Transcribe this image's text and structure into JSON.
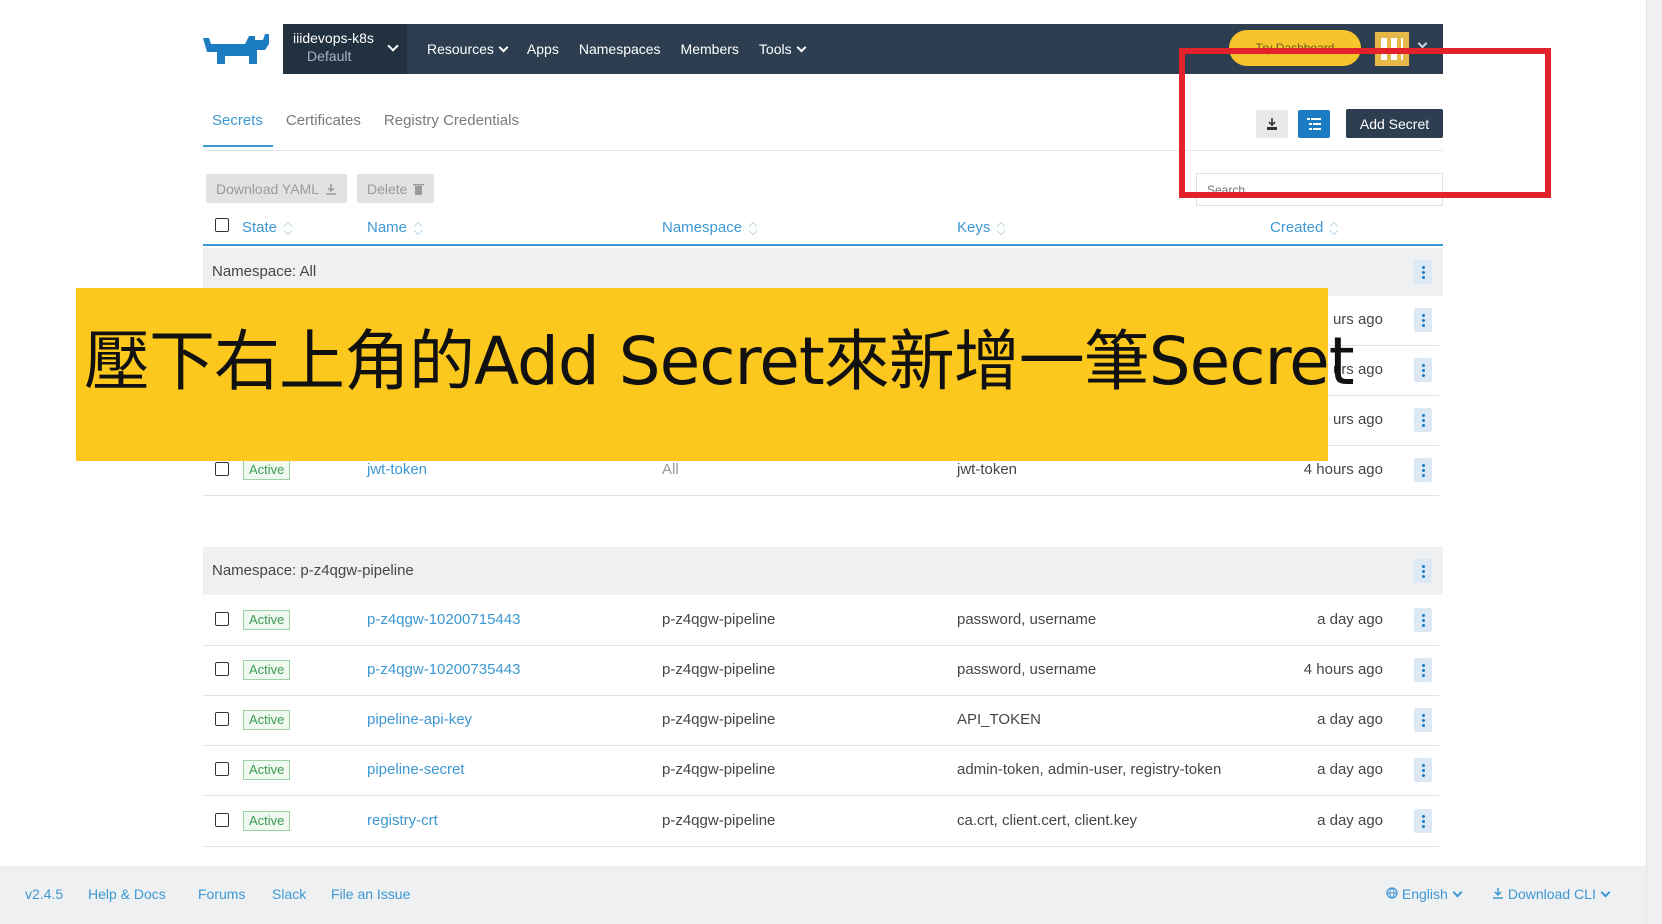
{
  "header": {
    "cluster_name": "iiidevops-k8s",
    "project_name": "Default",
    "nav": [
      "Resources",
      "Apps",
      "Namespaces",
      "Members",
      "Tools"
    ],
    "dashboard_button": "Try Dashboard"
  },
  "tabs": [
    "Secrets",
    "Certificates",
    "Registry Credentials"
  ],
  "toolbar": {
    "add_secret": "Add Secret",
    "download_yaml": "Download YAML",
    "delete": "Delete",
    "search_placeholder": "Search"
  },
  "table": {
    "columns": [
      "State",
      "Name",
      "Namespace",
      "Keys",
      "Created"
    ],
    "groups": [
      {
        "label": "Namespace: All",
        "hidden_created": [
          "urs ago",
          "urs ago",
          "urs ago"
        ],
        "rows": [
          {
            "state": "Active",
            "name": "jwt-token",
            "namespace": "All",
            "keys": "jwt-token",
            "created": "4 hours ago"
          }
        ]
      },
      {
        "label": "Namespace: p-z4qgw-pipeline",
        "rows": [
          {
            "state": "Active",
            "name": "p-z4qgw-10200715443",
            "namespace": "p-z4qgw-pipeline",
            "keys": "password, username",
            "created": "a day ago"
          },
          {
            "state": "Active",
            "name": "p-z4qgw-10200735443",
            "namespace": "p-z4qgw-pipeline",
            "keys": "password, username",
            "created": "4 hours ago"
          },
          {
            "state": "Active",
            "name": "pipeline-api-key",
            "namespace": "p-z4qgw-pipeline",
            "keys": "API_TOKEN",
            "created": "a day ago"
          },
          {
            "state": "Active",
            "name": "pipeline-secret",
            "namespace": "p-z4qgw-pipeline",
            "keys": "admin-token, admin-user, registry-token",
            "created": "a day ago"
          },
          {
            "state": "Active",
            "name": "registry-crt",
            "namespace": "p-z4qgw-pipeline",
            "keys": "ca.crt, client.cert, client.key",
            "created": "a day ago"
          }
        ]
      }
    ]
  },
  "banner": {
    "text": "壓下右上角的Add Secret來新增一筆Secret"
  },
  "footer": {
    "version": "v2.4.5",
    "links": [
      "Help & Docs",
      "Forums",
      "Slack",
      "File an Issue"
    ],
    "language": "English",
    "download_cli": "Download CLI"
  },
  "colors": {
    "nav_bg": "#2d3e50",
    "accent": "#3d98d3",
    "banner": "#fdc81d",
    "highlight_box": "#e3212a",
    "active_badge": "#3d9a52"
  }
}
